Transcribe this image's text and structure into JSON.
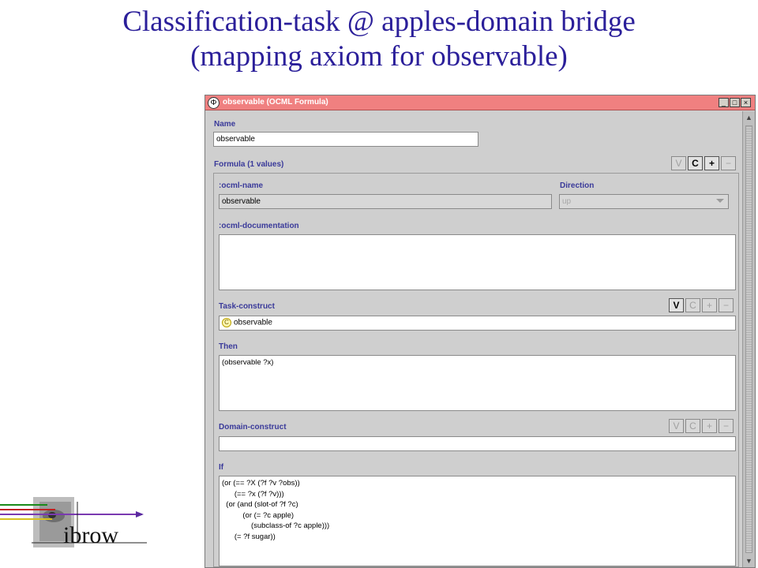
{
  "slide": {
    "title_line1": "Classification-task @ apples-domain bridge",
    "title_line2": "(mapping axiom for observable)"
  },
  "logo": {
    "text": "ibrow"
  },
  "window": {
    "title": "observable (OCML Formula)",
    "buttons": {
      "minimize": "_",
      "maximize": "□",
      "close": "×"
    }
  },
  "form": {
    "name_label": "Name",
    "name_value": "observable",
    "formula_label": "Formula (1 values)",
    "formula_buttons": {
      "v": "V",
      "c": "C",
      "plus": "+",
      "minus": "−"
    },
    "ocml_name_label": ":ocml-name",
    "ocml_name_value": "observable",
    "direction_label": "Direction",
    "direction_value": "up",
    "ocml_doc_label": ":ocml-documentation",
    "ocml_doc_value": "",
    "task_construct_label": "Task-construct",
    "task_construct_icon": "C",
    "task_construct_value": "observable",
    "task_buttons": {
      "v": "V",
      "c": "C",
      "plus": "+",
      "minus": "−"
    },
    "then_label": "Then",
    "then_value": "(observable ?x)",
    "domain_construct_label": "Domain-construct",
    "domain_buttons": {
      "v": "V",
      "c": "C",
      "plus": "+",
      "minus": "−"
    },
    "domain_construct_value": "",
    "if_label": "If",
    "if_value": "(or (== ?X (?f ?v ?obs))\n      (== ?x (?f ?v)))\n  (or (and (slot-of ?f ?c)\n          (or (= ?c apple)\n              (subclass-of ?c apple)))\n      (= ?f sugar))"
  },
  "colors": {
    "title": "#2b1f9a",
    "titlebar": "#f08080",
    "label": "#3a3a9a",
    "window_bg": "#cfcfcf"
  }
}
